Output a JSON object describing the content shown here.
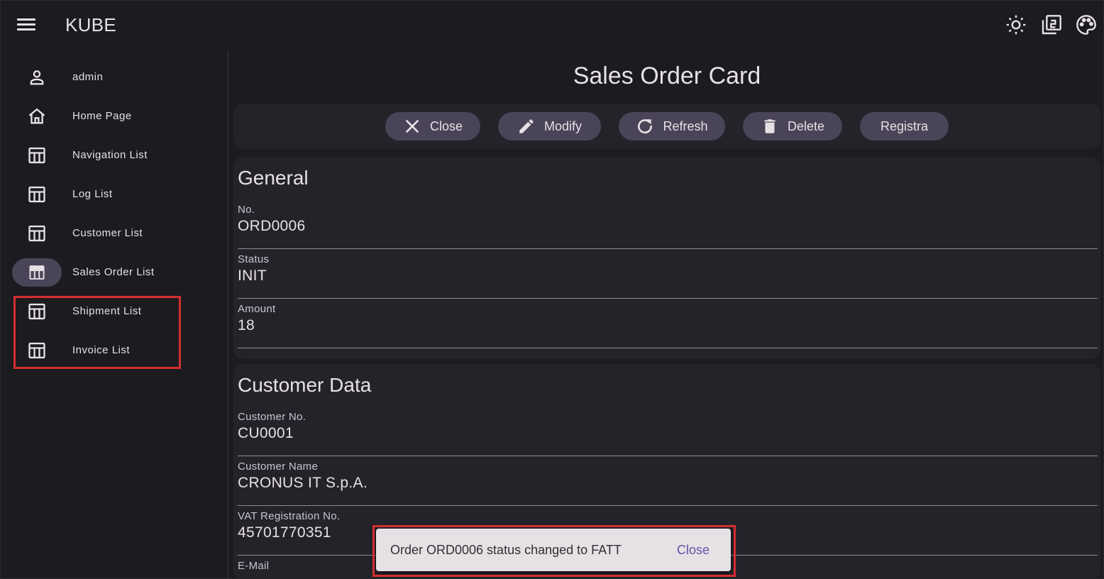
{
  "app": {
    "title": "KUBE"
  },
  "sidebar": {
    "items": [
      {
        "label": "admin",
        "icon": "person-icon"
      },
      {
        "label": "Home Page",
        "icon": "home-icon"
      },
      {
        "label": "Navigation List",
        "icon": "table-icon"
      },
      {
        "label": "Log List",
        "icon": "table-icon"
      },
      {
        "label": "Customer List",
        "icon": "table-icon"
      },
      {
        "label": "Sales Order List",
        "icon": "table-icon",
        "active": true
      },
      {
        "label": "Shipment List",
        "icon": "table-icon"
      },
      {
        "label": "Invoice List",
        "icon": "table-icon"
      }
    ]
  },
  "main": {
    "title": "Sales Order Card",
    "toolbar": {
      "close_label": "Close",
      "modify_label": "Modify",
      "refresh_label": "Refresh",
      "delete_label": "Delete",
      "registra_label": "Registra"
    },
    "general": {
      "title": "General",
      "fields": [
        {
          "label": "No.",
          "value": "ORD0006"
        },
        {
          "label": "Status",
          "value": "INIT"
        },
        {
          "label": "Amount",
          "value": "18"
        }
      ]
    },
    "customer": {
      "title": "Customer Data",
      "fields": [
        {
          "label": "Customer No.",
          "value": "CU0001"
        },
        {
          "label": "Customer Name",
          "value": "CRONUS IT S.p.A."
        },
        {
          "label": "VAT Registration No.",
          "value": "45701770351"
        },
        {
          "label": "E-Mail",
          "value": ""
        }
      ]
    }
  },
  "snackbar": {
    "message": "Order ORD0006 status changed to FATT",
    "action": "Close"
  },
  "colors": {
    "background": "#1c1b1f",
    "surface": "#25232a",
    "button": "#4a4458",
    "highlight": "#d32f2f",
    "snackbar_action": "#6750a4"
  }
}
